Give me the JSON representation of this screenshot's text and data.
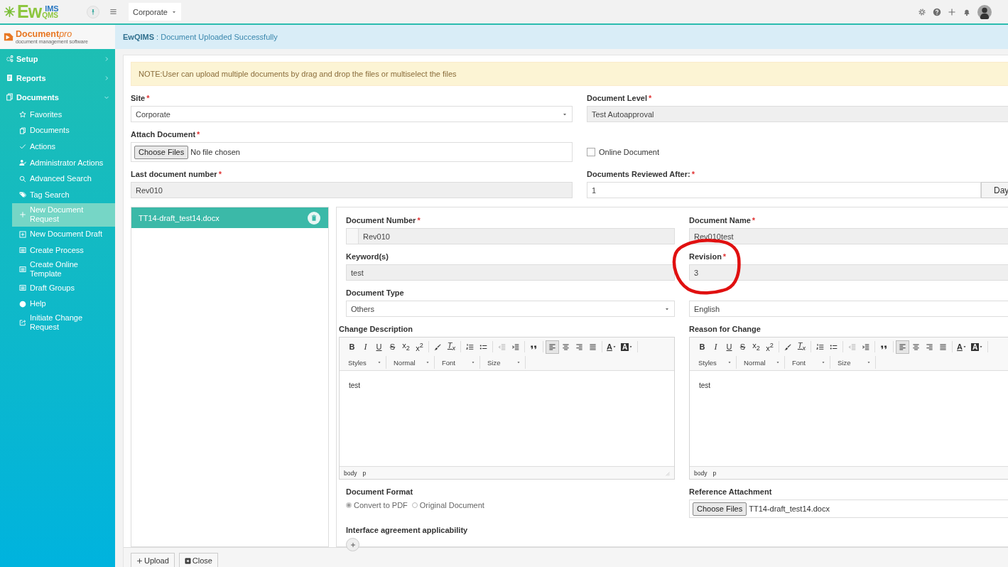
{
  "topbar": {
    "logo": {
      "ew": "Ew",
      "ims": "IMS",
      "qms": "QMS"
    },
    "site_select": {
      "value": "Corporate"
    }
  },
  "sidebar": {
    "brand": {
      "name": "Document",
      "suffix": "pro",
      "tagline": "document management software"
    },
    "items": [
      {
        "label": "Setup",
        "expanded": false
      },
      {
        "label": "Reports",
        "expanded": false
      },
      {
        "label": "Documents",
        "expanded": true,
        "children": [
          {
            "label": "Favorites",
            "selected": false
          },
          {
            "label": "Documents",
            "selected": false
          },
          {
            "label": "Actions",
            "selected": false
          },
          {
            "label": "Administrator Actions",
            "selected": false
          },
          {
            "label": "Advanced Search",
            "selected": false
          },
          {
            "label": "Tag Search",
            "selected": false
          },
          {
            "label": "New Document Request",
            "selected": true
          },
          {
            "label": "New Document Draft",
            "selected": false
          },
          {
            "label": "Create Process",
            "selected": false
          },
          {
            "label": "Create Online Template",
            "selected": false
          },
          {
            "label": "Draft Groups",
            "selected": false
          },
          {
            "label": "Help",
            "selected": false
          },
          {
            "label": "Initiate Change Request",
            "selected": false
          }
        ]
      }
    ]
  },
  "alert": {
    "source": "EwQIMS",
    "message": ": Document Uploaded Successfully"
  },
  "note": "NOTE:User can upload multiple documents by drag and drop the files or multiselect the files",
  "form": {
    "site": {
      "label": "Site",
      "mark": "*",
      "value": "Corporate"
    },
    "document_level": {
      "label": "Document Level",
      "mark": "*",
      "value": "Test Autoapproval"
    },
    "attach_document": {
      "label": "Attach Document",
      "mark": "*",
      "button": "Choose Files",
      "status": "No file chosen"
    },
    "online_document": {
      "label": "Online Document",
      "checked": false
    },
    "last_document_number": {
      "label": "Last document number",
      "mark": "*",
      "value": "Rev010"
    },
    "documents_reviewed_after": {
      "label": "Documents Reviewed After:",
      "mark": "*",
      "value": "1",
      "unit": "Day"
    }
  },
  "files": [
    {
      "name": "TT14-draft_test14.docx",
      "selected": true
    }
  ],
  "details": {
    "document_number": {
      "label": "Document Number",
      "mark": "*",
      "value": "Rev010"
    },
    "document_name": {
      "label": "Document Name",
      "mark": "*",
      "value": "Rev010test"
    },
    "keywords": {
      "label": "Keyword(s)",
      "value": "test"
    },
    "revision": {
      "label": "Revision",
      "mark": "*",
      "value": "3"
    },
    "document_type": {
      "label": "Document Type",
      "value": "Others"
    },
    "language": {
      "value": "English"
    },
    "change_description": {
      "label": "Change Description",
      "content": "test",
      "path": [
        "body",
        "p"
      ],
      "resizable": true,
      "toolbar": [
        [
          {
            "kind": "bold",
            "label": "B",
            "on": false,
            "disabled": false
          },
          {
            "kind": "italic",
            "label": "I",
            "on": false,
            "disabled": false
          },
          {
            "kind": "underline",
            "label": "U",
            "on": false,
            "disabled": false
          },
          {
            "kind": "strike",
            "label": "S",
            "on": false,
            "disabled": false
          },
          {
            "kind": "subscript",
            "label": "x$_{2}$",
            "on": false,
            "disabled": false
          },
          {
            "kind": "superscript",
            "label": "x$^{2}$",
            "on": false,
            "disabled": false
          }
        ],
        [
          {
            "kind": "brush",
            "on": false,
            "disabled": false
          },
          {
            "kind": "clear",
            "label": "T$_{x}$",
            "on": false,
            "disabled": false
          }
        ],
        [
          {
            "kind": "numbered",
            "on": false,
            "disabled": false
          },
          {
            "kind": "bulleted",
            "on": false,
            "disabled": false
          }
        ],
        [
          {
            "kind": "outdent",
            "on": false,
            "disabled": true
          },
          {
            "kind": "indent",
            "on": false,
            "disabled": false
          }
        ],
        [
          {
            "kind": "quote",
            "on": false,
            "disabled": false
          }
        ],
        [
          {
            "kind": "align-left",
            "on": true,
            "disabled": false
          },
          {
            "kind": "align-center",
            "on": false,
            "disabled": false
          },
          {
            "kind": "align-right",
            "on": false,
            "disabled": false
          },
          {
            "kind": "justify",
            "on": false,
            "disabled": false
          }
        ],
        [
          {
            "kind": "text-color",
            "label": "A",
            "on": false,
            "disabled": false
          },
          {
            "kind": "bg-color",
            "label": "A",
            "on": false,
            "disabled": false
          }
        ]
      ],
      "combos": [
        {
          "label": "Styles"
        },
        {
          "label": "Normal"
        },
        {
          "label": "Font"
        },
        {
          "label": "Size"
        }
      ]
    },
    "reason_for_change": {
      "label": "Reason for Change",
      "content": "test",
      "path": [
        "body",
        "p"
      ],
      "toolbar": [
        [
          {
            "kind": "bold",
            "label": "B",
            "on": false,
            "disabled": false
          },
          {
            "kind": "italic",
            "label": "I",
            "on": false,
            "disabled": false
          },
          {
            "kind": "underline",
            "label": "U",
            "on": false,
            "disabled": false
          },
          {
            "kind": "strike",
            "label": "S",
            "on": false,
            "disabled": false
          },
          {
            "kind": "subscript",
            "label": "x$_{2}$",
            "on": false,
            "disabled": false
          },
          {
            "kind": "superscript",
            "label": "x$^{2}$",
            "on": false,
            "disabled": false
          }
        ],
        [
          {
            "kind": "brush",
            "on": false,
            "disabled": false
          },
          {
            "kind": "clear",
            "label": "T$_{x}$",
            "on": false,
            "disabled": false
          }
        ],
        [
          {
            "kind": "numbered",
            "on": false,
            "disabled": false
          },
          {
            "kind": "bulleted",
            "on": false,
            "disabled": false
          }
        ],
        [
          {
            "kind": "outdent",
            "on": false,
            "disabled": true
          },
          {
            "kind": "indent",
            "on": false,
            "disabled": false
          }
        ],
        [
          {
            "kind": "quote",
            "on": false,
            "disabled": false
          }
        ],
        [
          {
            "kind": "align-left",
            "on": true,
            "disabled": false
          },
          {
            "kind": "align-center",
            "on": false,
            "disabled": false
          },
          {
            "kind": "align-right",
            "on": false,
            "disabled": false
          },
          {
            "kind": "justify",
            "on": false,
            "disabled": false
          }
        ],
        [
          {
            "kind": "text-color",
            "label": "A",
            "on": false,
            "disabled": false
          },
          {
            "kind": "bg-color",
            "label": "A",
            "on": false,
            "disabled": false
          }
        ]
      ],
      "combos": [
        {
          "label": "Styles"
        },
        {
          "label": "Normal"
        },
        {
          "label": "Font"
        },
        {
          "label": "Size"
        }
      ]
    },
    "document_format": {
      "label": "Document Format",
      "options": [
        {
          "label": "Convert to PDF",
          "selected": true
        },
        {
          "label": "Original Document",
          "selected": false
        }
      ]
    },
    "reference_attachment": {
      "label": "Reference Attachment",
      "button": "Choose Files",
      "file": "TT14-draft_test14.docx"
    },
    "interface_agreement": {
      "label": "Interface agreement applicability"
    }
  },
  "footer": {
    "buttons": [
      {
        "kind": "upload",
        "label": "Upload"
      },
      {
        "kind": "close",
        "label": "Close"
      }
    ]
  }
}
